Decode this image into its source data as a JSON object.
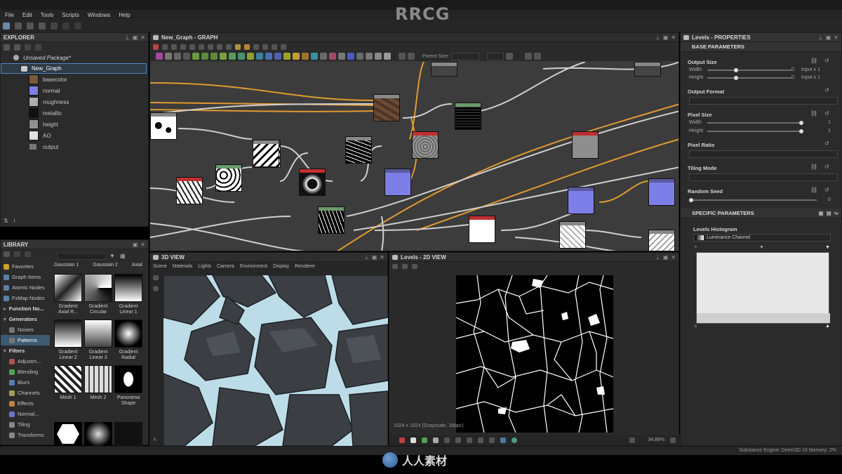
{
  "brand": "RRCG",
  "menu": [
    "File",
    "Edit",
    "Tools",
    "Scripts",
    "Windows",
    "Help"
  ],
  "explorer": {
    "title": "EXPLORER",
    "package": "Unsaved Package*",
    "graph": "New_Graph",
    "outputs": [
      {
        "label": "basecolor",
        "color": "#7a5a3a"
      },
      {
        "label": "normal",
        "color": "#7e7ee8"
      },
      {
        "label": "roughness",
        "color": "#b0b0b0"
      },
      {
        "label": "metallic",
        "color": "#111111"
      },
      {
        "label": "height",
        "color": "#909090"
      },
      {
        "label": "AO",
        "color": "#e0e0e0"
      },
      {
        "label": "output",
        "color": ""
      }
    ]
  },
  "library": {
    "title": "LIBRARY",
    "categories": [
      {
        "label": "Favorites",
        "type": "item",
        "color": "#c9a227"
      },
      {
        "label": "Graph Items",
        "type": "item",
        "color": "#5a7fa0"
      },
      {
        "label": "Atomic Nodes",
        "type": "item",
        "color": "#5a7fa0"
      },
      {
        "label": "FxMap Nodes",
        "type": "item",
        "color": "#5a7fa0"
      },
      {
        "label": "Function No...",
        "type": "head",
        "color": ""
      },
      {
        "label": "Generators",
        "type": "head",
        "color": ""
      },
      {
        "label": "Noises",
        "type": "sub",
        "color": "#777"
      },
      {
        "label": "Patterns",
        "type": "sel",
        "color": "#777"
      },
      {
        "label": "Filters",
        "type": "head",
        "color": ""
      },
      {
        "label": "Adjustm...",
        "type": "sub",
        "color": "#b05050"
      },
      {
        "label": "Blending",
        "type": "sub",
        "color": "#50a050"
      },
      {
        "label": "Blurs",
        "type": "sub",
        "color": "#5080b0"
      },
      {
        "label": "Channels",
        "type": "sub",
        "color": "#a0a050"
      },
      {
        "label": "Effects",
        "type": "sub",
        "color": "#c08040"
      },
      {
        "label": "Normal...",
        "type": "sub",
        "color": "#7070d0"
      },
      {
        "label": "Tiling",
        "type": "sub",
        "color": "#888"
      },
      {
        "label": "Transforms",
        "type": "sub",
        "color": "#888"
      }
    ],
    "top_labels": [
      "Gaussian 1",
      "Gaussian 2",
      "Axial"
    ],
    "items": [
      {
        "label": "Gradient Axial R...",
        "style": "axial"
      },
      {
        "label": "Gradient Circular",
        "style": "circular"
      },
      {
        "label": "Gradient Linear 1",
        "style": "linear1"
      },
      {
        "label": "Gradient Linear 2",
        "style": "linear2"
      },
      {
        "label": "Gradient Linear 3",
        "style": "linear3"
      },
      {
        "label": "Gradient Radial",
        "style": "radial"
      },
      {
        "label": "Mesh 1",
        "style": "mesh1"
      },
      {
        "label": "Mesh 2",
        "style": "mesh2"
      },
      {
        "label": "Panorama Shape",
        "style": "panorama"
      }
    ]
  },
  "graph": {
    "title": "New_Graph - GRAPH",
    "parent_size_label": "Parent Size:"
  },
  "view3d": {
    "title": "3D VIEW",
    "menu": [
      "Scene",
      "Materials",
      "Lights",
      "Camera",
      "Environment",
      "Display",
      "Renderer"
    ]
  },
  "view2d": {
    "title": "Levels - 2D VIEW",
    "status": "1024 x 1024 (Grayscale, 16bpc)",
    "zoom": "34.86%"
  },
  "properties": {
    "title": "Levels - PROPERTIES",
    "base_section": "BASE PARAMETERS",
    "output_size": "Output Size",
    "width": "Width",
    "height": "Height",
    "width_val": "0",
    "height_val": "0",
    "width_mode": "Input x 1",
    "height_mode": "Input x 1",
    "output_format": "Output Format",
    "pixel_size": "Pixel Size",
    "ps_width": "Width",
    "ps_height": "Height",
    "ps_width_val": "1",
    "ps_height_val": "1",
    "pixel_ratio": "Pixel Ratio",
    "tiling_mode": "Tiling Mode",
    "random_seed": "Random Seed",
    "random_seed_val": "0",
    "specific_section": "SPECIFIC PARAMETERS",
    "histogram_label": "Levels Histogram",
    "channel": "Luminance Channel"
  },
  "statusbar": {
    "engine": "Substance Engine: Direct3D 10  Memory: 2%"
  },
  "footer_logo": "人人素材"
}
